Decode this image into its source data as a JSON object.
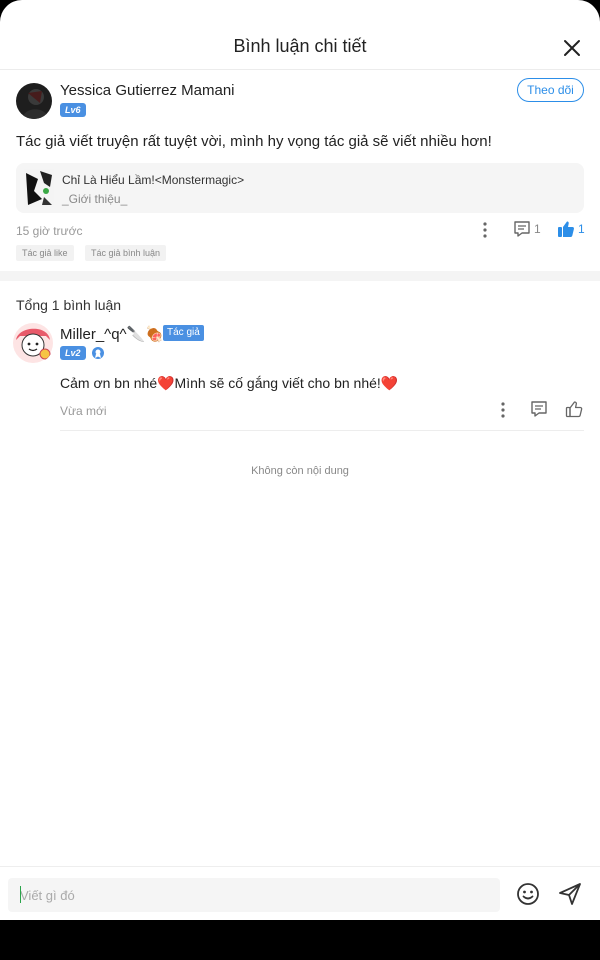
{
  "header": {
    "title": "Bình luận chi tiết"
  },
  "main_comment": {
    "user_name": "Yessica Gutierrez Mamani",
    "level": "Lv6",
    "follow_label": "Theo dõi",
    "text": "Tác giả viết truyện rất tuyệt vời, mình hy vọng tác giả sẽ viết nhiều hơn!",
    "book": {
      "title": "Chỉ Là Hiểu Lầm!<Monstermagic>",
      "description": "_Giới thiệu_"
    },
    "time": "15 giờ trước",
    "reply_count": "1",
    "like_count": "1",
    "tags": [
      "Tác giả like",
      "Tác giả bình luận"
    ]
  },
  "replies_section": {
    "total_label": "Tổng 1 bình luận"
  },
  "reply": {
    "user_name": "Miller_^q^🔪🍖",
    "author_tag": "Tác giả",
    "level": "Lv2",
    "text": "Cảm ơn bn nhé❤️Mình sẽ cố gắng viết cho bn nhé!❤️",
    "time": "Vừa mới"
  },
  "footer": {
    "no_more": "Không còn nội dung"
  },
  "input": {
    "placeholder": "Viết gì đó"
  },
  "colors": {
    "accent": "#2c8ee8",
    "badge": "#4a90e2",
    "heart": "#e53935"
  }
}
